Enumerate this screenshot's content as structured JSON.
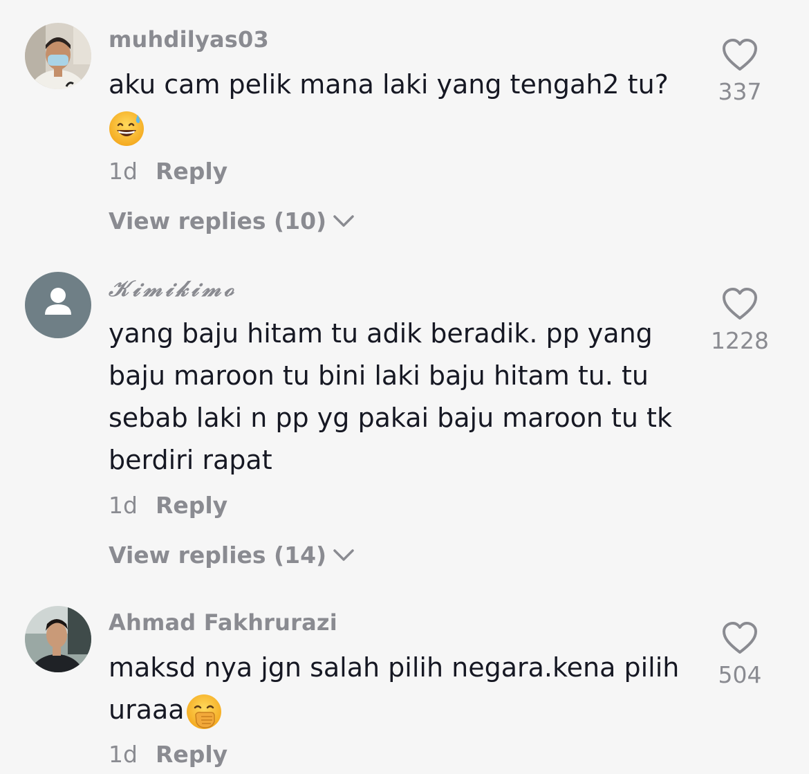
{
  "comments": [
    {
      "username": "muhdilyas03",
      "text": "aku cam pelik mana laki yang tengah2 tu?",
      "emoji": "grinning-sweat-emoji",
      "time": "1d",
      "reply_label": "Reply",
      "view_replies": "View replies (10)",
      "likes": "337"
    },
    {
      "username": "𝒦𝒾𝓂𝒾𝓀𝒾𝓂ℴ",
      "text": "yang baju hitam tu adik beradik. pp yang baju maroon tu bini laki baju hitam tu. tu sebab laki n pp yg pakai baju maroon tu tk berdiri rapat",
      "time": "1d",
      "reply_label": "Reply",
      "view_replies": "View replies (14)",
      "likes": "1228"
    },
    {
      "username": "Ahmad Fakhrurazi",
      "text": "maksd nya jgn salah pilih negara.kena pilih uraaa",
      "emoji": "face-with-hand-over-mouth-emoji",
      "time": "1d",
      "reply_label": "Reply",
      "likes": "504"
    }
  ],
  "colors": {
    "background": "#f6f6f6",
    "text": "#161823",
    "muted": "#8a8b91",
    "default_avatar": "#6f7f86"
  }
}
